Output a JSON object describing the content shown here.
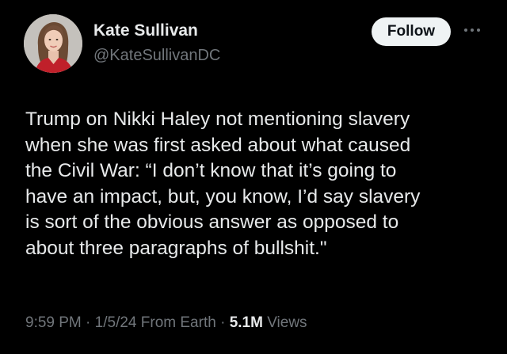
{
  "author": {
    "display_name": "Kate Sullivan",
    "handle": "@KateSullivanDC"
  },
  "actions": {
    "follow_label": "Follow",
    "more_icon": "more-horizontal-icon"
  },
  "tweet": {
    "lines": [
      "Trump on Nikki Haley not mentioning slavery",
      "when she was first asked about what caused",
      "the Civil War: “I don’t know that it’s going to",
      "have an impact, but, you know, I’d say slavery",
      "is sort of the obvious answer as opposed to",
      "about three paragraphs of bullshit.\""
    ]
  },
  "meta": {
    "time": "9:59 PM",
    "date": "1/5/24",
    "source": "From Earth",
    "views_count": "5.1M",
    "views_label": "Views",
    "separator": "·"
  },
  "colors": {
    "background": "#000000",
    "primary_text": "#e7e9ea",
    "secondary_text": "#71767b",
    "follow_bg": "#eff3f4",
    "follow_text": "#0f1419"
  }
}
